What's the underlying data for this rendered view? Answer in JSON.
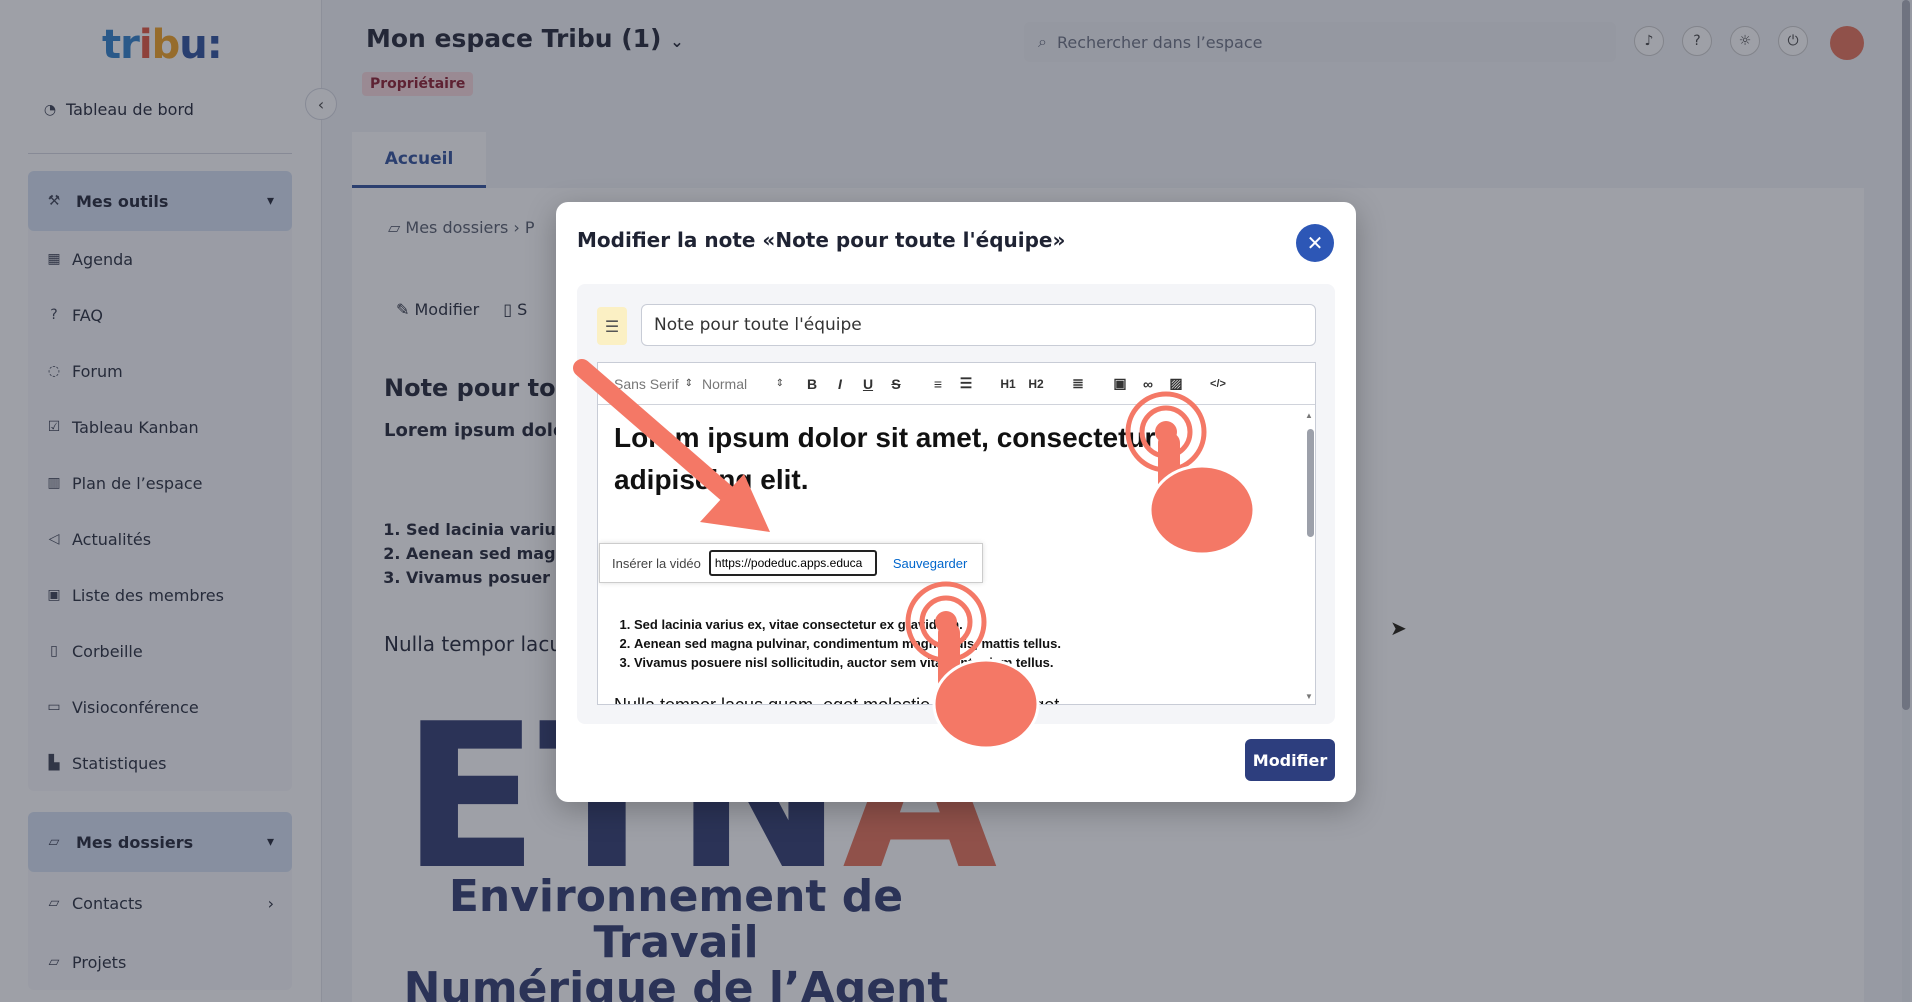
{
  "sidebar": {
    "logo": [
      "tr",
      "i",
      "b",
      "u:"
    ],
    "dashboard": "Tableau de bord",
    "tools_group": {
      "label": "Mes outils",
      "items": [
        "Agenda",
        "FAQ",
        "Forum",
        "Tableau Kanban",
        "Plan de l’espace",
        "Actualités",
        "Liste des membres",
        "Corbeille",
        "Visioconférence",
        "Statistiques"
      ]
    },
    "folders_group": {
      "label": "Mes dossiers",
      "items": [
        "Contacts",
        "Projets"
      ]
    }
  },
  "header": {
    "title": "Mon espace Tribu (1)",
    "role": "Propriétaire",
    "search_placeholder": "Rechercher dans l’espace"
  },
  "tabs": {
    "home": "Accueil"
  },
  "content": {
    "breadcrumb": "Mes dossiers",
    "breadcrumb_next": "P",
    "modify": "Modifier",
    "delete": "S",
    "note_title": "Note pour tout",
    "note_sub": "Lorem ipsum dolo",
    "list": [
      "Sed lacinia variu",
      "Aenean sed mag",
      "Vivamus posuer"
    ],
    "para": "Nulla tempor lacu",
    "etna_line1": "Environnement de Travail",
    "etna_line2": "Numérique de l’Agent"
  },
  "modal": {
    "title": "Modifier la note «Note pour toute l'équipe»",
    "title_input": "Note pour toute l'équipe",
    "toolbar": {
      "font": "Sans Serif",
      "size": "Normal",
      "bold": "B",
      "italic": "I",
      "underline": "U",
      "strike": "S",
      "h1": "H1",
      "h2": "H2",
      "code": "</>"
    },
    "editor_heading": "Lorem ipsum dolor sit amet, consectetur adipiscing elit.",
    "video_label": "Insérer la vidéo",
    "video_url": "https://podeduc.apps.educa",
    "video_save": "Sauvegarder",
    "list": [
      "Sed lacinia varius ex, vitae consectetur ex gravida in.",
      "Aenean sed magna pulvinar, condimentum magna quis, mattis tellus.",
      "Vivamus posuere nisl sollicitudin, auctor sem vitae, interdum tellus."
    ],
    "para": "Nulla tempor lacus quam, eget molestie leo laoreet eget.",
    "submit": "Modifier"
  },
  "colors": {
    "accent": "#2d57b6",
    "submit": "#2d3e7e",
    "annotation": "#f47866"
  }
}
